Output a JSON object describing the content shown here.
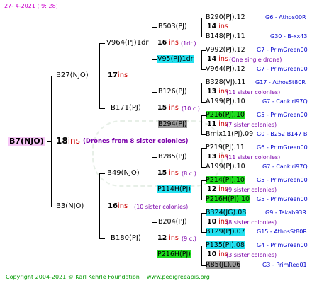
{
  "date": "27-  4-2021  (  9:  28)",
  "footer": {
    "copyright": "Copyright 2004-2021 © Karl Kehrle Foundation",
    "site": "www.pedigreeapis.org"
  },
  "root": {
    "name": "B7(NJO)",
    "count": "18",
    "ins": "ins",
    "note": "(Drones from 8 sister colonies)"
  },
  "gen1": [
    {
      "name": "B27(NJO)",
      "count": "17",
      "ins": "ins"
    },
    {
      "name": "B3(NJO)",
      "count": "16",
      "ins": "ins",
      "note": "(10 sister colonies)"
    }
  ],
  "gen2": [
    {
      "name": "V964(PJ)1dr",
      "count": "16",
      "ins": "ins",
      "note": "(1dr.)"
    },
    {
      "name": "B171(PJ)",
      "count": "15",
      "ins": "ins",
      "note": "(10 c.)"
    },
    {
      "name": "B49(NJO)",
      "count": "15",
      "ins": "ins",
      "note": "(8 c.)"
    },
    {
      "name": "B180(PJ)",
      "count": "12",
      "ins": "ins",
      "note": "(9 c.)"
    }
  ],
  "gen3": [
    {
      "name": "B503(PJ)",
      "count": "14",
      "ins": "ins"
    },
    {
      "name": "V95(PJ)1dr",
      "count": "14",
      "ins": "ins",
      "note": "(One single drone)"
    },
    {
      "name": "B126(PJ)",
      "count": "13",
      "ins": "ins",
      "note": "(11 sister colonies)"
    },
    {
      "name": "B294(PJ)",
      "count": "11",
      "ins": "ins",
      "note": "(7 sister colonies)"
    },
    {
      "name": "B285(PJ)",
      "count": "13",
      "ins": "ins",
      "note": "(11 sister colonies)"
    },
    {
      "name": "P114H(PJ)",
      "count": "12",
      "ins": "ins",
      "note": "(9 sister colonies)"
    },
    {
      "name": "B204(PJ)",
      "count": "10",
      "ins": "ins",
      "note": "(8 sister colonies)"
    },
    {
      "name": "P216H(PJ)",
      "count": "10",
      "ins": "ins",
      "note": "(3 sister colonies)"
    }
  ],
  "gen4": [
    {
      "name": "B290(PJ).12",
      "info": "G6 - Athos00R"
    },
    {
      "name": "B148(PJ).11",
      "info": "G30 - B-xx43"
    },
    {
      "name": "V992(PJ).12",
      "info": "G7 - PrimGreen00"
    },
    {
      "name": "V964(PJ).12",
      "info": "G7 - PrimGreen00"
    },
    {
      "name": "B328(VJ).11",
      "info": "G17 - AthosSt80R"
    },
    {
      "name": "A199(PJ).10",
      "info": "G7 - Cankiri97Q"
    },
    {
      "name": "P216(PJ).10",
      "info": "G5 - PrimGreen00"
    },
    {
      "name": "Bmix11(PJ).09",
      "info": "G0 - B252 B147 B"
    },
    {
      "name": "P219(PJ).11",
      "info": "G6 - PrimGreen00"
    },
    {
      "name": "A199(PJ).10",
      "info": "G7 - Cankiri97Q"
    },
    {
      "name": "P214(PJ).10",
      "info": "G5 - PrimGreen00"
    },
    {
      "name": "P216H(PJ).10",
      "info": "G5 - PrimGreen00"
    },
    {
      "name": "B324(JG).08",
      "info": "G9 - Takab93R"
    },
    {
      "name": "B129(PJ).07",
      "info": "G15 - AthosSt80R"
    },
    {
      "name": "P135(PJ).08",
      "info": "G4 - PrimGreen00"
    },
    {
      "name": "R85(JL).06",
      "info": "G3 - PrimRed01"
    }
  ]
}
